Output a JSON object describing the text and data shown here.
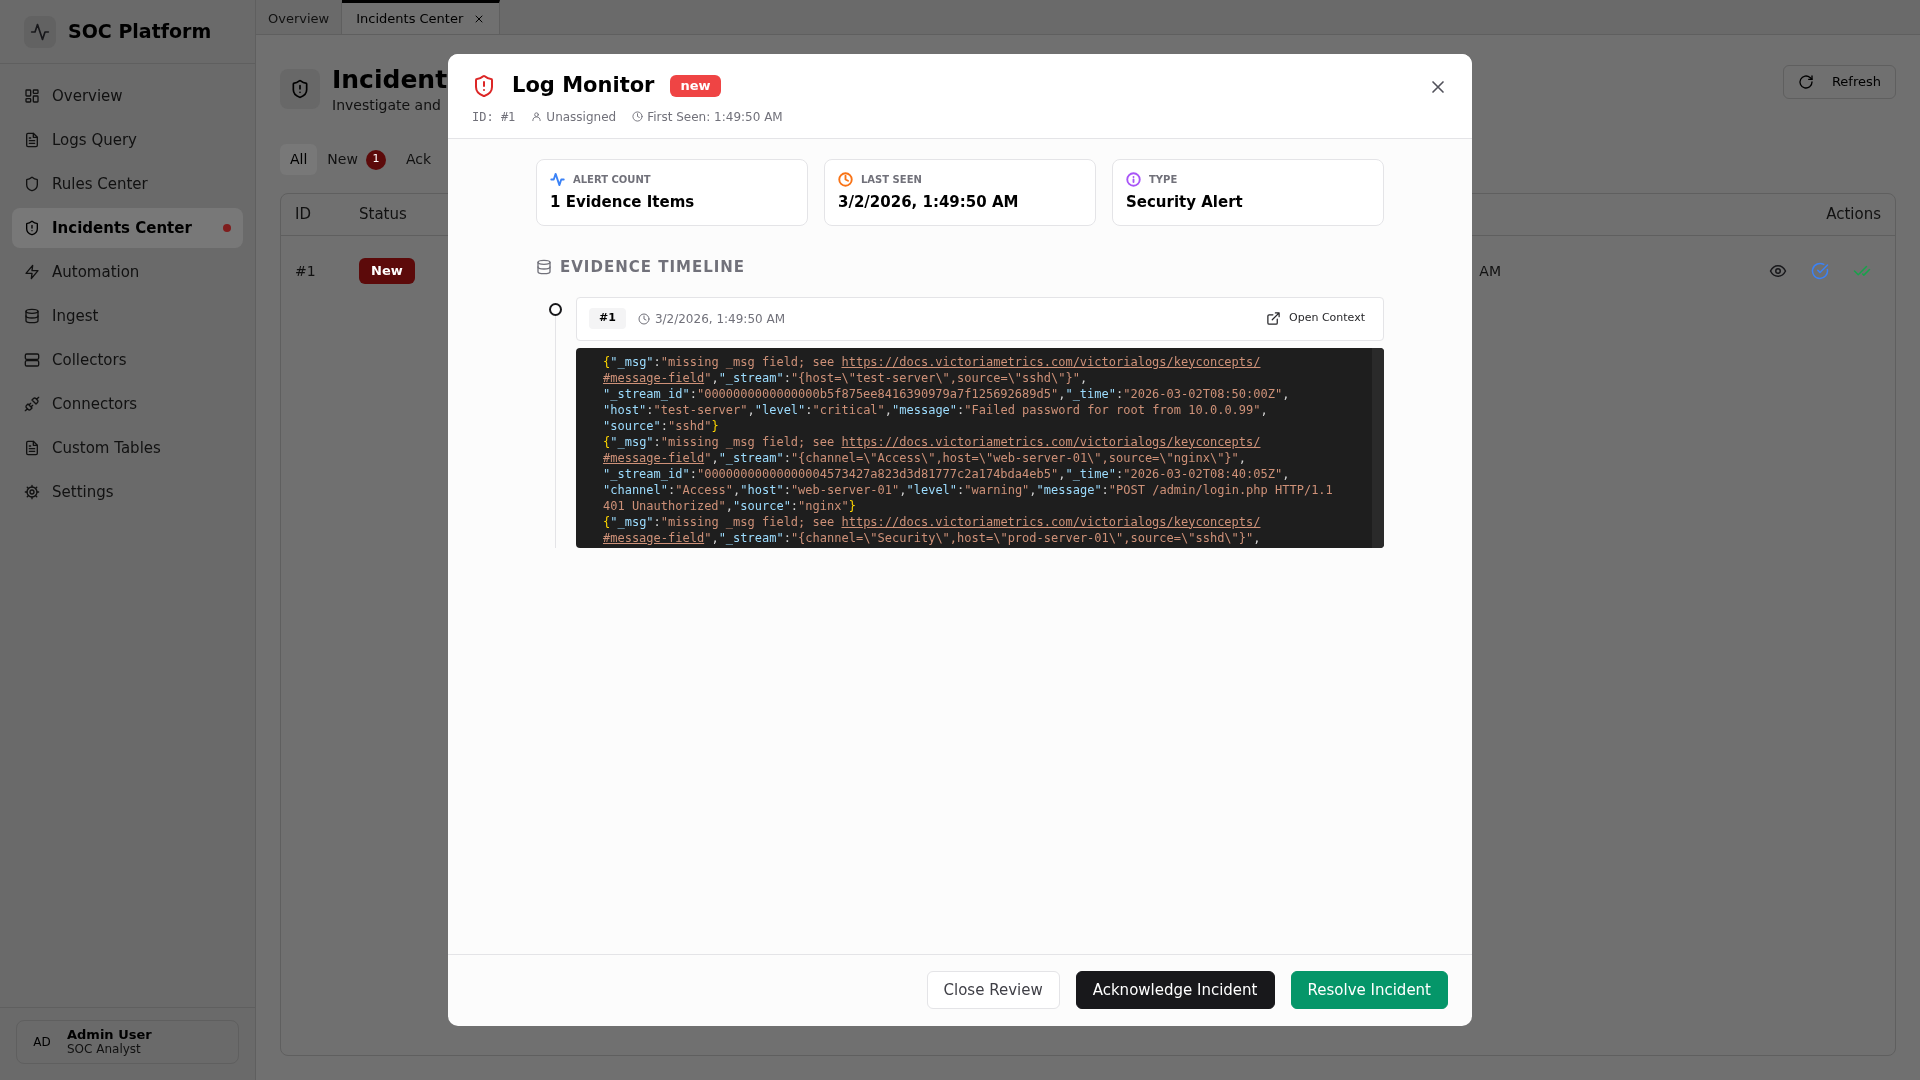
{
  "sidebar": {
    "brand": "SOC Platform",
    "items": [
      {
        "label": "Overview",
        "selected": false,
        "alert": false
      },
      {
        "label": "Logs Query",
        "selected": false,
        "alert": false
      },
      {
        "label": "Rules Center",
        "selected": false,
        "alert": false
      },
      {
        "label": "Incidents Center",
        "selected": true,
        "alert": true
      },
      {
        "label": "Automation",
        "selected": false,
        "alert": false
      },
      {
        "label": "Ingest",
        "selected": false,
        "alert": false
      },
      {
        "label": "Collectors",
        "selected": false,
        "alert": false
      },
      {
        "label": "Connectors",
        "selected": false,
        "alert": false
      },
      {
        "label": "Custom Tables",
        "selected": false,
        "alert": false
      },
      {
        "label": "Settings",
        "selected": false,
        "alert": false
      }
    ],
    "user": {
      "initials": "AD",
      "name": "Admin User",
      "role": "SOC Analyst"
    }
  },
  "tabs": [
    {
      "label": "Overview",
      "selected": false,
      "closable": false
    },
    {
      "label": "Incidents Center",
      "selected": true,
      "closable": true
    }
  ],
  "page": {
    "title": "Incident",
    "subtitle": "Investigate and",
    "refresh": "Refresh",
    "filters": [
      {
        "label": "All",
        "selected": true
      },
      {
        "label": "New",
        "count": "1",
        "selected": false
      },
      {
        "label": "Ack",
        "selected": false
      }
    ],
    "table": {
      "columns": [
        "ID",
        "Status",
        "Actions"
      ],
      "rows": [
        {
          "id": "#1",
          "status": "New",
          "column_3": "AM"
        }
      ]
    }
  },
  "modal": {
    "title": "Log Monitor",
    "badge": "new",
    "id": "ID: #1",
    "assignee": "Unassigned",
    "first_seen": "First Seen: 1:49:50 AM",
    "stats": [
      {
        "label": "ALERT COUNT",
        "value": "1 Evidence Items",
        "color": "#3b82f6"
      },
      {
        "label": "LAST SEEN",
        "value": "3/2/2026, 1:49:50 AM",
        "color": "#f97316"
      },
      {
        "label": "TYPE",
        "value": "Security Alert",
        "color": "#a855f7"
      }
    ],
    "section_title": "EVIDENCE TIMELINE",
    "evidence": [
      {
        "index": "#1",
        "time": "3/2/2026, 1:49:50 AM",
        "action": "Open Context",
        "log_lines": [
          [
            {
              "kind": "brace",
              "text": "{"
            },
            {
              "kind": "key",
              "text": "\"_msg\""
            },
            {
              "kind": "punct",
              "text": ":"
            },
            {
              "kind": "string",
              "text": "\"missing _msg field; see "
            },
            {
              "kind": "link",
              "text": "https://docs.victoriametrics.com/victorialogs/keyconcepts/"
            }
          ],
          [
            {
              "kind": "link",
              "text": "#message-field"
            },
            {
              "kind": "string",
              "text": "\""
            },
            {
              "kind": "punct",
              "text": ","
            },
            {
              "kind": "key",
              "text": "\"_stream\""
            },
            {
              "kind": "punct",
              "text": ":"
            },
            {
              "kind": "string",
              "text": "\"{host=\\\"test-server\\\",source=\\\"sshd\\\"}\""
            },
            {
              "kind": "punct",
              "text": ","
            }
          ],
          [
            {
              "kind": "key",
              "text": "\"_stream_id\""
            },
            {
              "kind": "punct",
              "text": ":"
            },
            {
              "kind": "string",
              "text": "\"0000000000000000b5f875ee8416390979a7f125692689d5\""
            },
            {
              "kind": "punct",
              "text": ","
            },
            {
              "kind": "key",
              "text": "\"_time\""
            },
            {
              "kind": "punct",
              "text": ":"
            },
            {
              "kind": "string",
              "text": "\"2026-03-02T08:50:00Z\""
            },
            {
              "kind": "punct",
              "text": ","
            }
          ],
          [
            {
              "kind": "key",
              "text": "\"host\""
            },
            {
              "kind": "punct",
              "text": ":"
            },
            {
              "kind": "string",
              "text": "\"test-server\""
            },
            {
              "kind": "punct",
              "text": ","
            },
            {
              "kind": "key",
              "text": "\"level\""
            },
            {
              "kind": "punct",
              "text": ":"
            },
            {
              "kind": "string",
              "text": "\"critical\""
            },
            {
              "kind": "punct",
              "text": ","
            },
            {
              "kind": "key",
              "text": "\"message\""
            },
            {
              "kind": "punct",
              "text": ":"
            },
            {
              "kind": "string",
              "text": "\"Failed password for root from 10.0.0.99\""
            },
            {
              "kind": "punct",
              "text": ","
            }
          ],
          [
            {
              "kind": "key",
              "text": "\"source\""
            },
            {
              "kind": "punct",
              "text": ":"
            },
            {
              "kind": "string",
              "text": "\"sshd\""
            },
            {
              "kind": "brace",
              "text": "}"
            }
          ],
          [
            {
              "kind": "brace",
              "text": "{"
            },
            {
              "kind": "key",
              "text": "\"_msg\""
            },
            {
              "kind": "punct",
              "text": ":"
            },
            {
              "kind": "string",
              "text": "\"missing _msg field; see "
            },
            {
              "kind": "link",
              "text": "https://docs.victoriametrics.com/victorialogs/keyconcepts/"
            }
          ],
          [
            {
              "kind": "link",
              "text": "#message-field"
            },
            {
              "kind": "string",
              "text": "\""
            },
            {
              "kind": "punct",
              "text": ","
            },
            {
              "kind": "key",
              "text": "\"_stream\""
            },
            {
              "kind": "punct",
              "text": ":"
            },
            {
              "kind": "string",
              "text": "\"{channel=\\\"Access\\\",host=\\\"web-server-01\\\",source=\\\"nginx\\\"}\""
            },
            {
              "kind": "punct",
              "text": ","
            }
          ],
          [
            {
              "kind": "key",
              "text": "\"_stream_id\""
            },
            {
              "kind": "punct",
              "text": ":"
            },
            {
              "kind": "string",
              "text": "\"00000000000000004573427a823d3d81777c2a174bda4eb5\""
            },
            {
              "kind": "punct",
              "text": ","
            },
            {
              "kind": "key",
              "text": "\"_time\""
            },
            {
              "kind": "punct",
              "text": ":"
            },
            {
              "kind": "string",
              "text": "\"2026-03-02T08:40:05Z\""
            },
            {
              "kind": "punct",
              "text": ","
            }
          ],
          [
            {
              "kind": "key",
              "text": "\"channel\""
            },
            {
              "kind": "punct",
              "text": ":"
            },
            {
              "kind": "string",
              "text": "\"Access\""
            },
            {
              "kind": "punct",
              "text": ","
            },
            {
              "kind": "key",
              "text": "\"host\""
            },
            {
              "kind": "punct",
              "text": ":"
            },
            {
              "kind": "string",
              "text": "\"web-server-01\""
            },
            {
              "kind": "punct",
              "text": ","
            },
            {
              "kind": "key",
              "text": "\"level\""
            },
            {
              "kind": "punct",
              "text": ":"
            },
            {
              "kind": "string",
              "text": "\"warning\""
            },
            {
              "kind": "punct",
              "text": ","
            },
            {
              "kind": "key",
              "text": "\"message\""
            },
            {
              "kind": "punct",
              "text": ":"
            },
            {
              "kind": "string",
              "text": "\"POST /admin/login.php HTTP/1.1"
            }
          ],
          [
            {
              "kind": "string",
              "text": "401 Unauthorized\""
            },
            {
              "kind": "punct",
              "text": ","
            },
            {
              "kind": "key",
              "text": "\"source\""
            },
            {
              "kind": "punct",
              "text": ":"
            },
            {
              "kind": "string",
              "text": "\"nginx\""
            },
            {
              "kind": "brace",
              "text": "}"
            }
          ],
          [
            {
              "kind": "brace",
              "text": "{"
            },
            {
              "kind": "key",
              "text": "\"_msg\""
            },
            {
              "kind": "punct",
              "text": ":"
            },
            {
              "kind": "string",
              "text": "\"missing _msg field; see "
            },
            {
              "kind": "link",
              "text": "https://docs.victoriametrics.com/victorialogs/keyconcepts/"
            }
          ],
          [
            {
              "kind": "link",
              "text": "#message-field"
            },
            {
              "kind": "string",
              "text": "\""
            },
            {
              "kind": "punct",
              "text": ","
            },
            {
              "kind": "key",
              "text": "\"_stream\""
            },
            {
              "kind": "punct",
              "text": ":"
            },
            {
              "kind": "string",
              "text": "\"{channel=\\\"Security\\\",host=\\\"prod-server-01\\\",source=\\\"sshd\\\"}\""
            },
            {
              "kind": "punct",
              "text": ","
            }
          ]
        ]
      }
    ],
    "buttons": [
      {
        "label": "Close Review",
        "kind": "outline"
      },
      {
        "label": "Acknowledge Incident",
        "kind": "dark"
      },
      {
        "label": "Resolve Incident",
        "kind": "success"
      }
    ]
  }
}
